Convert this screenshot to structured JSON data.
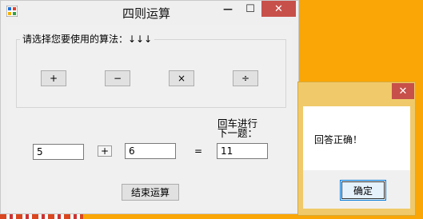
{
  "main_window": {
    "title": "四则运算",
    "minimize_glyph": "—",
    "maximize_glyph": "☐",
    "close_glyph": "✕",
    "group_label": "请选择您要使用的算法：↓↓↓",
    "op_buttons": [
      "+",
      "−",
      "×",
      "÷"
    ],
    "operand1": "5",
    "operator": "+",
    "operand2": "6",
    "equals": "=",
    "answer": "11",
    "hint": "回车进行下一题：",
    "end_button": "结束运算"
  },
  "message_box": {
    "close_glyph": "✕",
    "text": "回答正确！",
    "ok_button": "确定"
  },
  "colors": {
    "desktop": "#f9a606",
    "close_red": "#c7504a",
    "msgbox_frame": "#f0ca6a"
  }
}
